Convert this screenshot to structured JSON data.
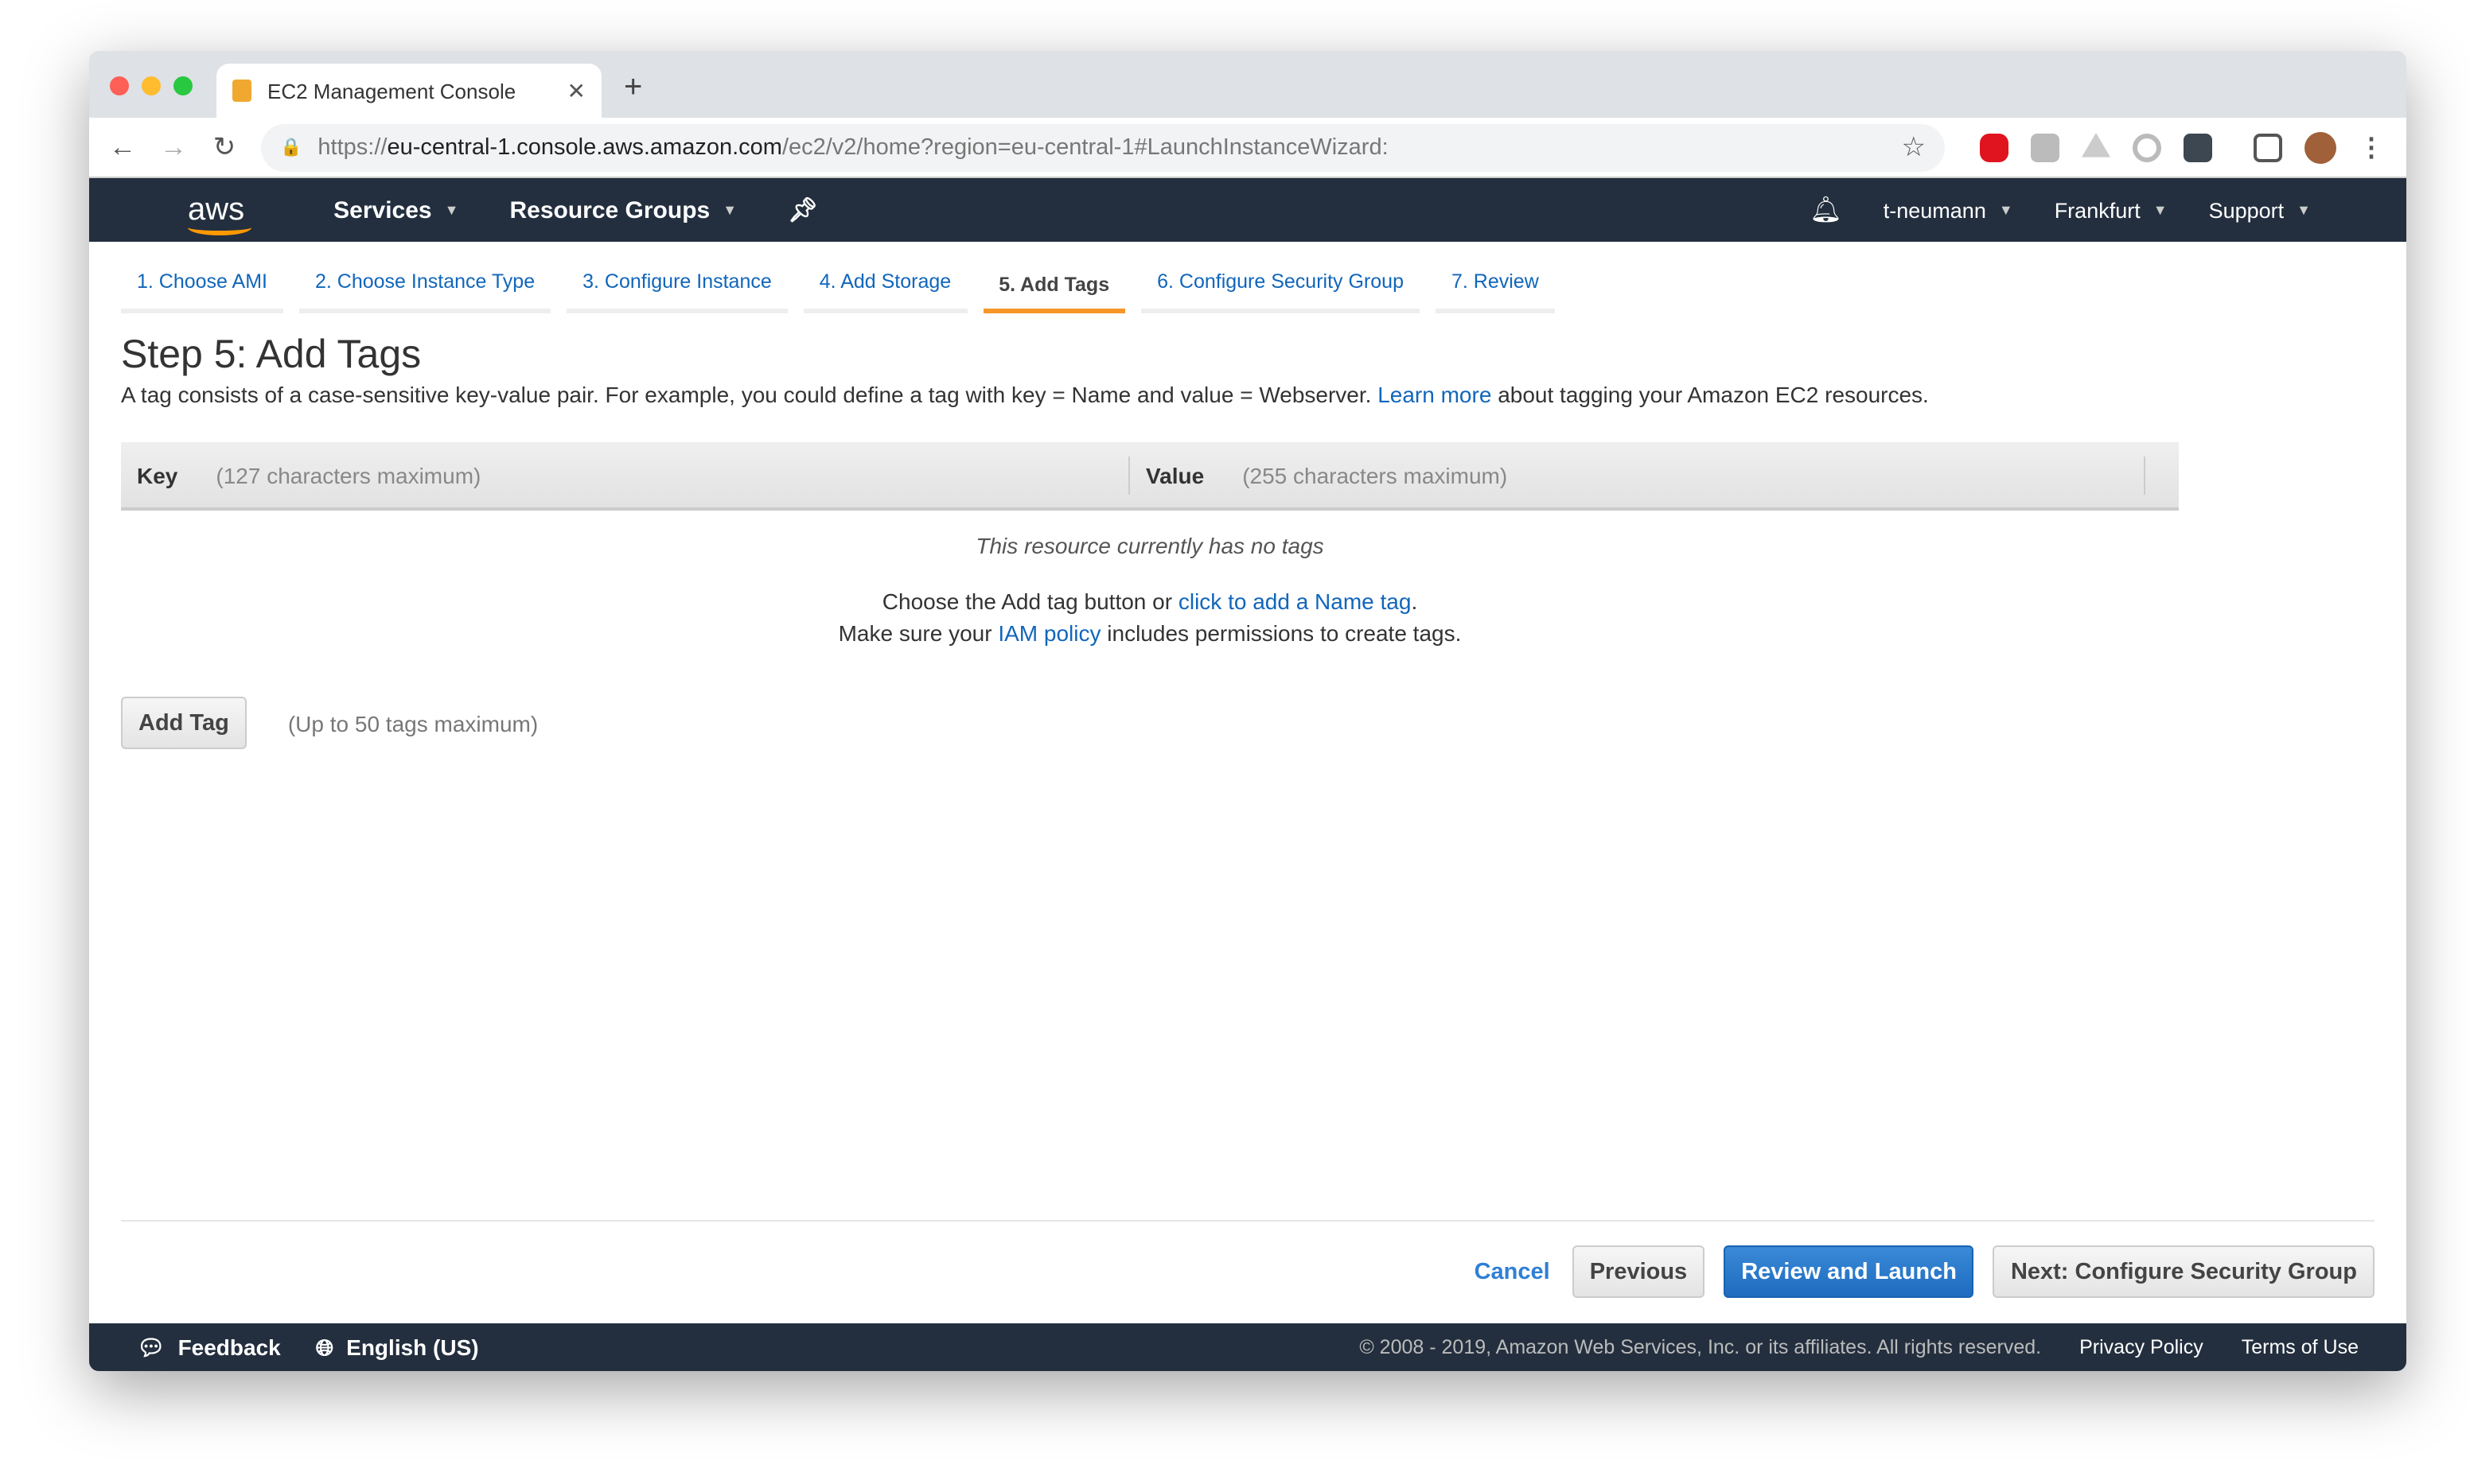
{
  "browser": {
    "tab_title": "EC2 Management Console",
    "url_scheme": "https://",
    "url_host": "eu-central-1.console.aws.amazon.com",
    "url_path": "/ec2/v2/home?region=eu-central-1#LaunchInstanceWizard:"
  },
  "nav": {
    "logo": "aws",
    "services": "Services",
    "resource_groups": "Resource Groups",
    "user": "t-neumann",
    "region": "Frankfurt",
    "support": "Support"
  },
  "wizard_tabs": [
    "1. Choose AMI",
    "2. Choose Instance Type",
    "3. Configure Instance",
    "4. Add Storage",
    "5. Add Tags",
    "6. Configure Security Group",
    "7. Review"
  ],
  "active_tab": "5. Add Tags",
  "page": {
    "title": "Step 5: Add Tags",
    "desc_pre": "A tag consists of a case-sensitive key-value pair. For example, you could define a tag with key = Name and value = Webserver.",
    "learn_more": "Learn more",
    "desc_post": "about tagging your Amazon EC2 resources."
  },
  "table": {
    "key_label": "Key",
    "key_hint": "(127 characters maximum)",
    "value_label": "Value",
    "value_hint": "(255 characters maximum)",
    "empty": "This resource currently has no tags",
    "line1_pre": "Choose the Add tag button or",
    "line1_link": "click to add a Name tag",
    "line1_post": ".",
    "line2_pre": "Make sure your",
    "line2_link": "IAM policy",
    "line2_post": "includes permissions to create tags."
  },
  "add_tag": {
    "button": "Add Tag",
    "hint": "(Up to 50 tags maximum)"
  },
  "actions": {
    "cancel": "Cancel",
    "previous": "Previous",
    "review": "Review and Launch",
    "next": "Next: Configure Security Group"
  },
  "footer": {
    "feedback": "Feedback",
    "language": "English (US)",
    "copyright": "© 2008 - 2019, Amazon Web Services, Inc. or its affiliates. All rights reserved.",
    "privacy": "Privacy Policy",
    "terms": "Terms of Use"
  },
  "colors": {
    "nav_bg": "#232f3e",
    "active_tab": "#f7962b",
    "link": "#1166bb",
    "primary": "#1e6bbf"
  }
}
